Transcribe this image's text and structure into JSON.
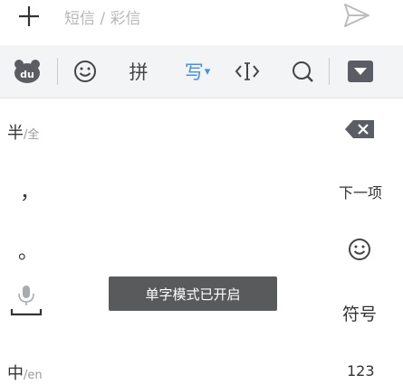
{
  "compose": {
    "placeholder": "短信 / 彩信"
  },
  "toolbar": {
    "pinyin_label": "拼",
    "handwrite_label": "写",
    "dropdown_arrow": "▾"
  },
  "keyboard": {
    "half_width_main": "半",
    "half_width_sub": "/全",
    "comma": "，",
    "period": "。",
    "next_item": "下一项",
    "symbol": "符号",
    "cn_en_main": "中",
    "cn_en_sub": "/en",
    "numeric": "123"
  },
  "toast": {
    "message": "单字模式已开启"
  },
  "colors": {
    "accent": "#4a90d9",
    "toolbar_bg": "#f3f4f6",
    "toast_bg": "#595a5c",
    "icon_dark": "#5a5d63"
  }
}
